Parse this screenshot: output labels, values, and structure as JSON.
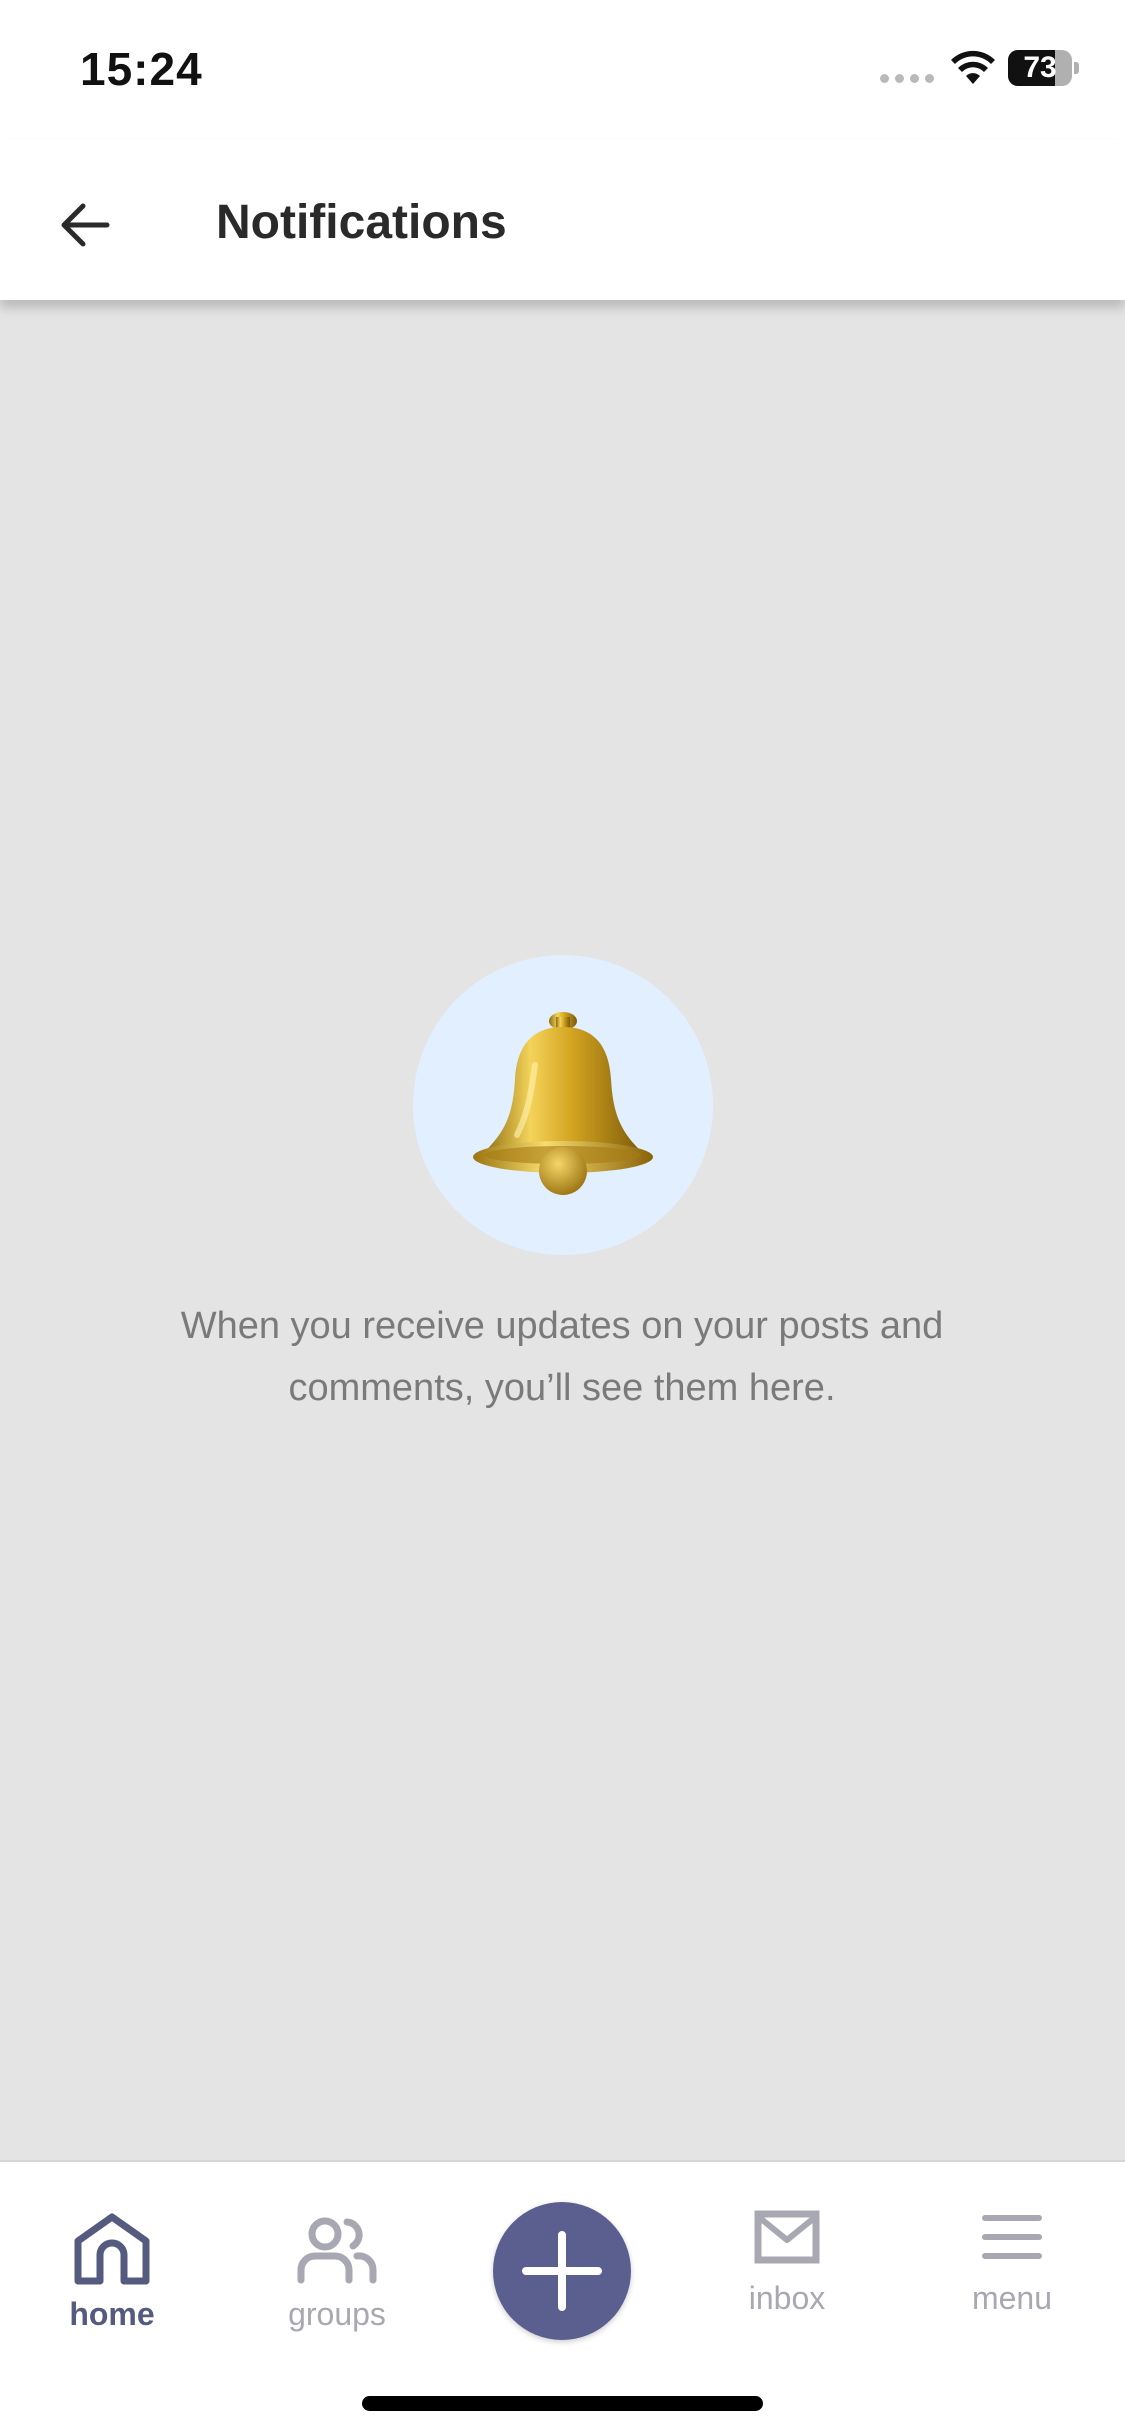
{
  "status_bar": {
    "time": "15:24",
    "battery": "73",
    "battery_level": 0.73,
    "icons": [
      "signal-dots-icon",
      "wifi-icon",
      "battery-icon"
    ]
  },
  "header": {
    "title": "Notifications",
    "back_icon": "arrow-left-icon"
  },
  "empty_state": {
    "icon": "bell-icon",
    "message": "When you receive updates on your posts and comments, you’ll see them here."
  },
  "bottom_nav": {
    "items": [
      {
        "label": "home",
        "icon": "home-icon",
        "active": true
      },
      {
        "label": "groups",
        "icon": "groups-icon",
        "active": false
      },
      {
        "label": "",
        "icon": "plus-icon",
        "active": false
      },
      {
        "label": "inbox",
        "icon": "mail-icon",
        "active": false
      },
      {
        "label": "menu",
        "icon": "hamburger-menu-icon",
        "active": false
      }
    ]
  },
  "colors": {
    "accent": "#5a5f8f",
    "background": "#e4e4e4",
    "bell_circle": "#e1efff",
    "inactive_nav": "#a8a8b2",
    "message_text": "#7a7a7a"
  }
}
